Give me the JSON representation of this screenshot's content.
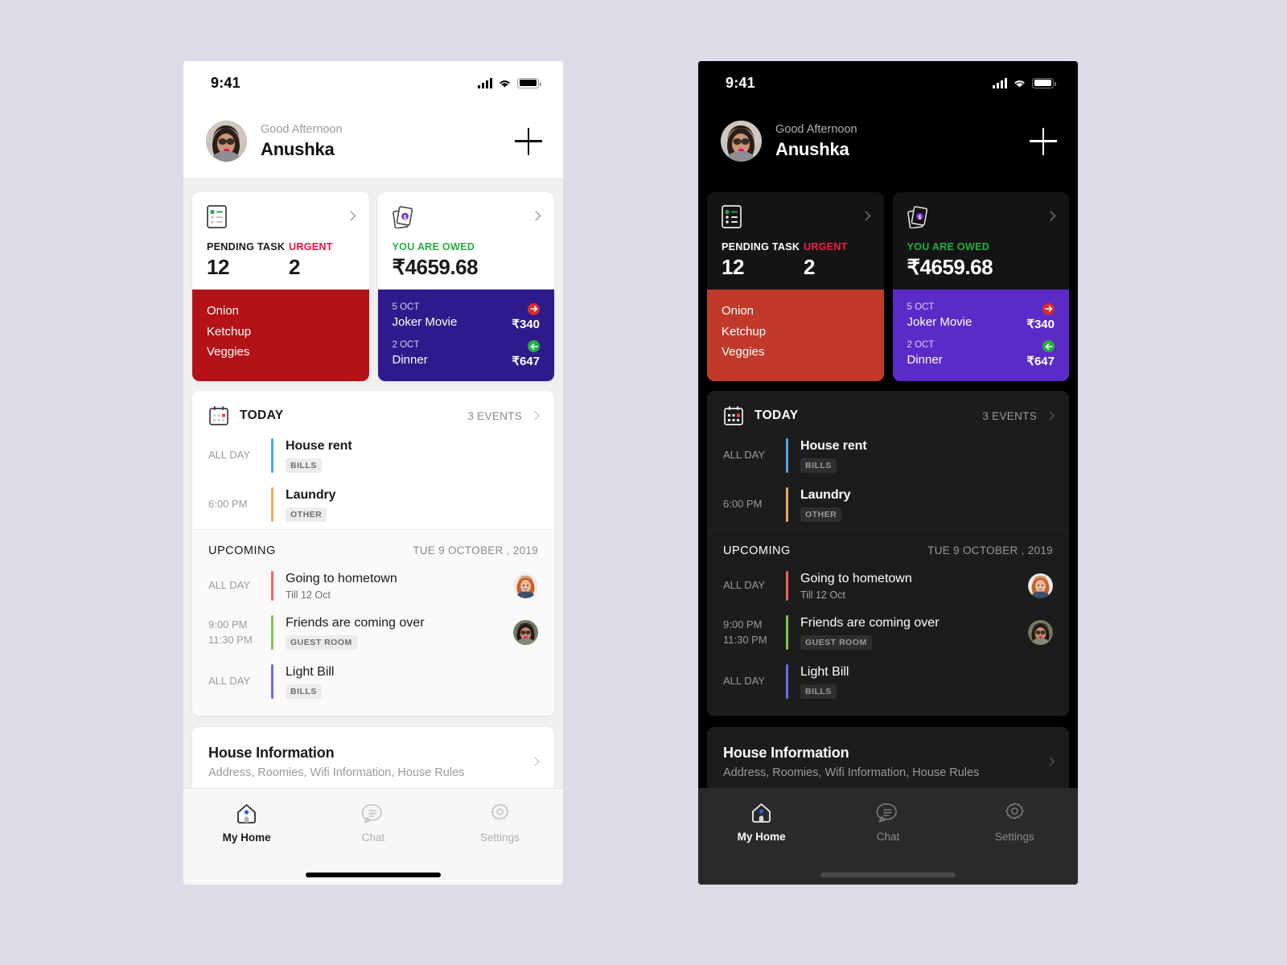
{
  "statusbar": {
    "time": "9:41"
  },
  "header": {
    "greeting": "Good Afternoon",
    "name": "Anushka",
    "add_label": "+"
  },
  "cards": {
    "tasks": {
      "label_pending": "PENDING TASK",
      "label_urgent": "URGENT",
      "count_pending": "12",
      "count_urgent": "2",
      "items": [
        "Onion",
        "Ketchup",
        "Veggies"
      ]
    },
    "owed": {
      "label": "YOU ARE OWED",
      "amount": "₹4659.68",
      "transactions": [
        {
          "date": "5 OCT",
          "title": "Joker Movie",
          "amount": "₹340",
          "direction": "out"
        },
        {
          "date": "2 OCT",
          "title": "Dinner",
          "amount": "₹647",
          "direction": "in"
        }
      ]
    }
  },
  "today": {
    "label": "TODAY",
    "count": "3 EVENTS",
    "events": [
      {
        "time": "ALL DAY",
        "time2": "",
        "title": "House rent",
        "tag": "BILLS",
        "sub": "",
        "color": "#4aa8e8"
      },
      {
        "time": "6:00 PM",
        "time2": "",
        "title": "Laundry",
        "tag": "OTHER",
        "sub": "",
        "color": "#f0a95c"
      }
    ]
  },
  "upcoming": {
    "label": "UPCOMING",
    "date": "TUE 9 OCTOBER , 2019",
    "events": [
      {
        "time": "ALL DAY",
        "time2": "",
        "title": "Going to hometown",
        "sub": "Till 12 Oct",
        "tag": "",
        "color": "#f4625f",
        "avatar": "redhead"
      },
      {
        "time": "9:00 PM",
        "time2": "11:30 PM",
        "title": "Friends are coming over",
        "sub": "",
        "tag": "GUEST ROOM",
        "color": "#7ec850",
        "avatar": "sunglasses"
      },
      {
        "time": "ALL DAY",
        "time2": "",
        "title": "Light Bill",
        "sub": "",
        "tag": "BILLS",
        "color": "#6b6bf0",
        "avatar": ""
      }
    ]
  },
  "house": {
    "title": "House Information",
    "subtitle": "Address, Roomies, Wifi Information, House Rules"
  },
  "tabs": [
    {
      "label": "My Home",
      "icon": "home-icon",
      "active": true
    },
    {
      "label": "Chat",
      "icon": "chat-icon",
      "active": false
    },
    {
      "label": "Settings",
      "icon": "gear-icon",
      "active": false
    }
  ],
  "colors": {
    "page_bg": "#dedbe8",
    "urgent": "#e8123c",
    "owed": "#27ae44",
    "grocery_light": "#b31217",
    "grocery_dark": "#c0392b",
    "txn_light": "#2e1a8c",
    "txn_dark": "#5b2bc8",
    "out": "#d92b2b",
    "in": "#27ae44"
  }
}
